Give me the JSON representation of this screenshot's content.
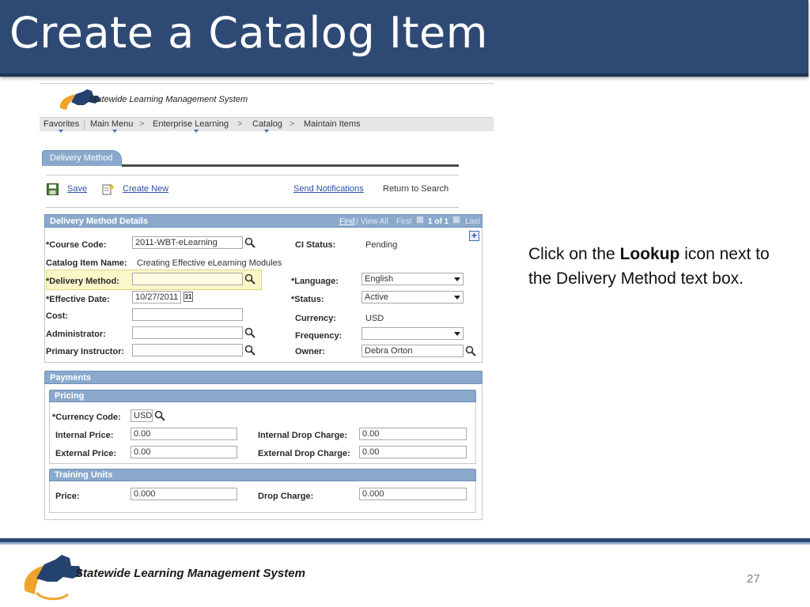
{
  "slide": {
    "title": "Create a Catalog Item",
    "page_number": "27",
    "instruction": {
      "prefix": "Click on the ",
      "bold": "Lookup",
      "suffix": " icon next to the Delivery Method text box."
    },
    "footer_logo_text": "Statewide Learning Management System"
  },
  "app": {
    "logo_text": "Statewide Learning Management System",
    "nav": {
      "favorites": "Favorites",
      "main_menu": "Main Menu",
      "enterprise_learning": "Enterprise Learning",
      "catalog": "Catalog",
      "maintain_items": "Maintain Items",
      "separator": ">"
    },
    "tab": "Delivery Method",
    "toolbar": {
      "save": "Save",
      "create_new": "Create New",
      "send_notifications": "Send Notifications",
      "return_to_search": "Return to Search"
    },
    "details": {
      "header": "Delivery Method Details",
      "pager": {
        "find": "Find",
        "view_all": "View All",
        "first": "First",
        "count": "1 of 1",
        "last": "Last"
      },
      "course_code_label": "*Course Code:",
      "course_code_value": "2011-WBT-eLearning",
      "ci_status_label": "CI Status:",
      "ci_status_value": "Pending",
      "catalog_item_name_label": "Catalog Item Name:",
      "catalog_item_name_value": "Creating Effective eLearning Modules",
      "delivery_method_label": "*Delivery Method:",
      "delivery_method_value": "",
      "language_label": "*Language:",
      "language_value": "English",
      "effective_date_label": "*Effective Date:",
      "effective_date_value": "10/27/2011",
      "calendar_glyph": "31",
      "status_label": "*Status:",
      "status_value": "Active",
      "cost_label": "Cost:",
      "cost_value": "",
      "currency_label": "Currency:",
      "currency_value": "USD",
      "administrator_label": "Administrator:",
      "administrator_value": "",
      "frequency_label": "Frequency:",
      "frequency_value": "",
      "primary_instructor_label": "Primary Instructor:",
      "primary_instructor_value": "",
      "owner_label": "Owner:",
      "owner_value": "Debra Orton",
      "expand_glyph": "+"
    },
    "payments": {
      "header": "Payments",
      "pricing_header": "Pricing",
      "currency_code_label": "*Currency Code:",
      "currency_code_value": "USD",
      "internal_price_label": "Internal Price:",
      "internal_price_value": "0.00",
      "internal_drop_label": "Internal Drop Charge:",
      "internal_drop_value": "0.00",
      "external_price_label": "External Price:",
      "external_price_value": "0.00",
      "external_drop_label": "External Drop Charge:",
      "external_drop_value": "0.00",
      "training_units_header": "Training Units",
      "price_label": "Price:",
      "price_value": "0.000",
      "drop_charge_label": "Drop Charge:",
      "drop_charge_value": "0.000"
    }
  },
  "colors": {
    "header_bg": "#2e4a74",
    "section_bar": "#8aa9cc",
    "highlight": "#fbf7c9",
    "link": "#2a4fa3"
  }
}
